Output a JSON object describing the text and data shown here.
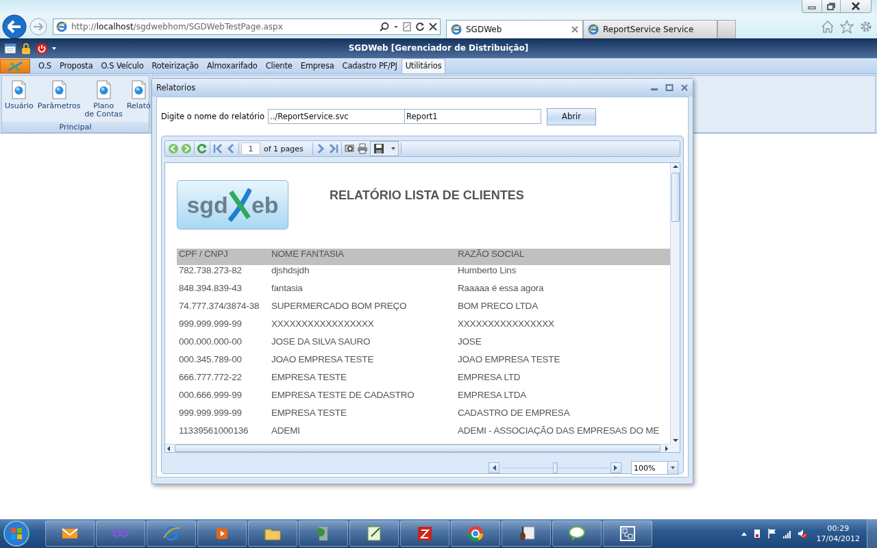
{
  "browser": {
    "address": {
      "scheme": "http://",
      "host": "localhost",
      "path": "/sgdwebhom/SGDWebTestPage.aspx"
    },
    "tabs": [
      {
        "label": "SGDWeb",
        "selected": true
      },
      {
        "label": "ReportService Service",
        "selected": false
      }
    ]
  },
  "app": {
    "title": "SGDWeb [Gerenciador de Distribuição]",
    "menu": [
      {
        "label": "O.S",
        "selected": false
      },
      {
        "label": "Proposta",
        "selected": false
      },
      {
        "label": "O.S Veículo",
        "selected": false
      },
      {
        "label": "Roteirização",
        "selected": false
      },
      {
        "label": "Almoxarifado",
        "selected": false
      },
      {
        "label": "Cliente",
        "selected": false
      },
      {
        "label": "Empresa",
        "selected": false
      },
      {
        "label": "Cadastro PF/PJ",
        "selected": false
      },
      {
        "label": "Utilitários",
        "selected": true
      }
    ],
    "ribbon": {
      "items": [
        "Usuário",
        "Parâmetros",
        "Plano\nde Contas",
        "Relató"
      ],
      "group": "Principal"
    }
  },
  "dialog": {
    "title": "Relatorios",
    "prompt": "Digite o nome do relatório",
    "service_field": {
      "value": "../ReportService.svc"
    },
    "report_field": {
      "value": "Report1"
    },
    "open_button": "Abrir",
    "viewer": {
      "page_field": {
        "value": "1"
      },
      "page_count": "of 1 pages",
      "logo": {
        "left": "sgd",
        "right": "eb"
      },
      "report_title": "RELATÓRIO LISTA DE CLIENTES",
      "table": {
        "columns": [
          "CPF / CNPJ",
          "NOME FANTASIA",
          "RAZÃO SOCIAL"
        ],
        "rows": [
          [
            "782.738.273-82",
            "djshdsjdh",
            "Humberto Lins"
          ],
          [
            "848.394.839-43",
            "fantasia",
            "Raaaaa é essa agora"
          ],
          [
            "74.777.374/3874-38",
            "SUPERMERCADO BOM PREÇO",
            "BOM PRECO LTDA"
          ],
          [
            "999.999.999-99",
            "XXXXXXXXXXXXXXXXX",
            "XXXXXXXXXXXXXXXX"
          ],
          [
            "000.000.000-00",
            "JOSE DA SILVA SAURO",
            "JOSE"
          ],
          [
            "000.345.789-00",
            "JOAO EMPRESA TESTE",
            "JOAO EMPRESA TESTE"
          ],
          [
            "666.777.772-22",
            "EMPRESA TESTE",
            "EMPRESA LTD"
          ],
          [
            "000.666.999-99",
            "EMPRESA TESTE DE CADASTRO",
            "EMPRESA LTDA"
          ],
          [
            "999.999.999-99",
            "EMPRESA TESTE",
            "CADASTRO DE EMPRESA"
          ],
          [
            "11339561000136",
            "ADEMI",
            "ADEMI - ASSOCIAÇÃO DAS EMPRESAS DO ME"
          ]
        ]
      },
      "zoom_slider": {
        "level": 0.5
      },
      "zoom_field": {
        "value": "100%"
      }
    }
  },
  "taskbar": {
    "time": "00:29",
    "date": "17/04/2012"
  }
}
